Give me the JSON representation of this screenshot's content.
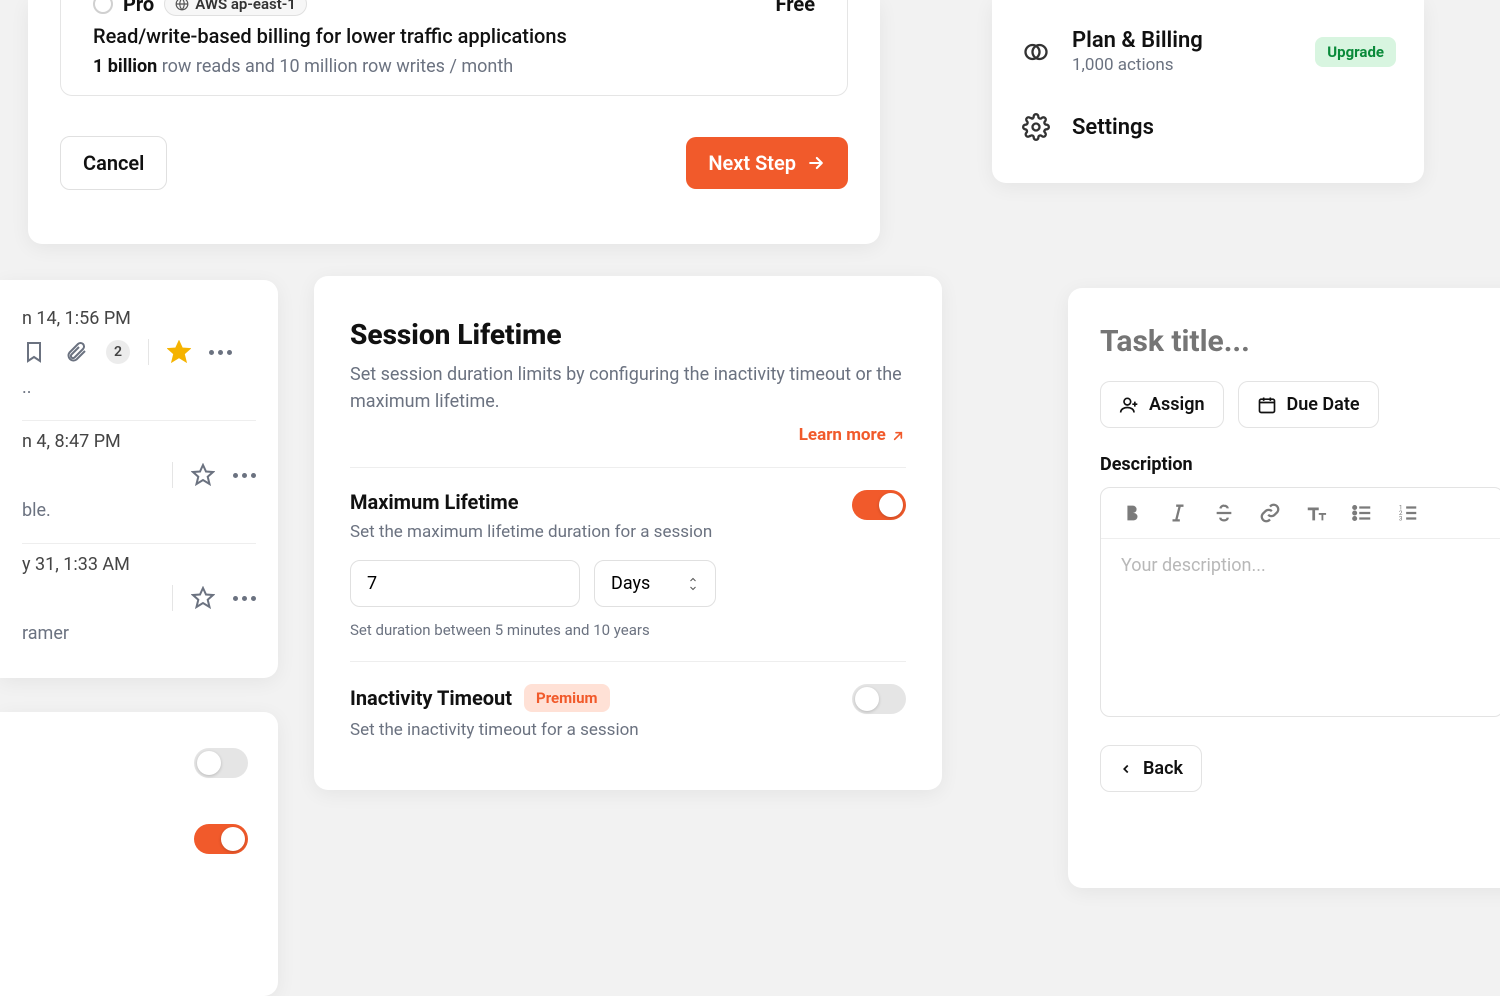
{
  "plan": {
    "name": "Pro",
    "provider": "AWS ap-east-1",
    "price": "Free",
    "description": "Read/write-based billing for lower traffic applications",
    "detail_bold": "1 billion",
    "detail_rest": "row reads and 10 million row writes / month",
    "cancel": "Cancel",
    "next": "Next Step"
  },
  "sidebar": {
    "plan_title": "Plan & Billing",
    "plan_sub": "1,000 actions",
    "upgrade": "Upgrade",
    "settings": "Settings"
  },
  "mail": {
    "items": [
      {
        "date": "n 14, 1:56 PM",
        "badge": "2",
        "starred": true,
        "snip": ".."
      },
      {
        "date": "n 4, 8:47 PM",
        "starred": false,
        "snip": "ble."
      },
      {
        "date": "y 31, 1:33 AM",
        "starred": false,
        "snip": "ramer"
      }
    ]
  },
  "toggles": {
    "a": false,
    "b": true
  },
  "session": {
    "title": "Session Lifetime",
    "sub": "Set session duration limits by configuring the inactivity timeout or the maximum lifetime.",
    "learn": "Learn more",
    "max_title": "Maximum Lifetime",
    "max_sub": "Set the maximum lifetime duration for a session",
    "max_value": "7",
    "max_unit": "Days",
    "max_help": "Set duration between 5 minutes and 10 years",
    "inact_title": "Inactivity Timeout",
    "inact_badge": "Premium",
    "inact_sub": "Set the inactivity timeout for a session"
  },
  "task": {
    "title_placeholder": "Task title...",
    "assign": "Assign",
    "due": "Due Date",
    "desc_label": "Description",
    "desc_placeholder": "Your description...",
    "back": "Back"
  }
}
